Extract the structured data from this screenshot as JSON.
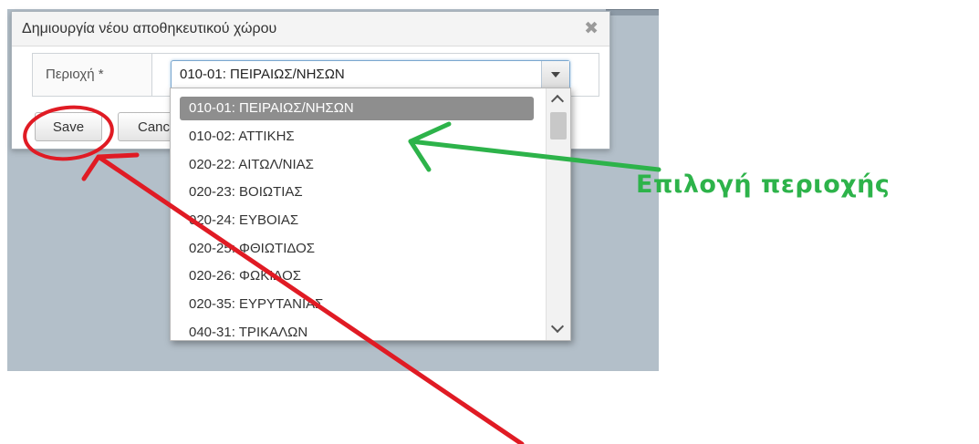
{
  "dialog": {
    "title": "Δημιουργία νέου αποθηκευτικού χώρου",
    "close_symbol": "✖"
  },
  "form": {
    "region_label": "Περιοχή *",
    "region_selected": "010-01: ΠΕΙΡΑΙΩΣ/ΝΗΣΩΝ"
  },
  "buttons": {
    "save_label": "Save",
    "cancel_label": "Cancel"
  },
  "dropdown": {
    "options": [
      "010-01: ΠΕΙΡΑΙΩΣ/ΝΗΣΩΝ",
      "010-02: ΑΤΤΙΚΗΣ",
      "020-22: ΑΙΤΩΛ/ΝΙΑΣ",
      "020-23: ΒΟΙΩΤΙΑΣ",
      "020-24: ΕΥΒΟΙΑΣ",
      "020-25: ΦΘΙΩΤΙΔΟΣ",
      "020-26: ΦΩΚΙΔΟΣ",
      "020-35: ΕΥΡΥΤΑΝΙΑΣ",
      "040-31: ΤΡΙΚΑΛΩΝ"
    ],
    "selected_index": 0
  },
  "annotations": {
    "region_hint": "Επιλογή περιοχής",
    "green_color": "#2db34a",
    "red_color": "#e01b24"
  }
}
